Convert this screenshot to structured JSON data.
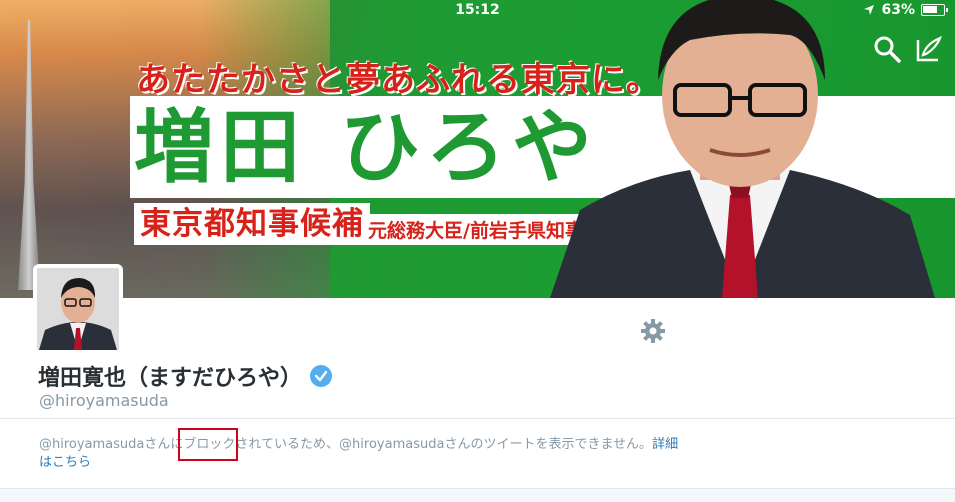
{
  "status_bar": {
    "time": "15:12",
    "battery": "63%"
  },
  "banner": {
    "slogan": "あたたかさと夢あふれる東京に。",
    "candidate_name": "増田 ひろや",
    "candidate_title": "東京都知事候補",
    "candidate_sub": "元総務大臣/前岩手県知事"
  },
  "profile": {
    "display_name": "増田寛也（ますだひろや）",
    "handle": "@hiroyamasuda",
    "verified": true
  },
  "blocked_notice": {
    "handle_1": "@hiroyamasuda",
    "text_1": "さんに",
    "highlighted": "ブロック",
    "text_2": "されているため、",
    "handle_2": "@hiroyamasuda",
    "text_3": "さんのツイートを表示できません。",
    "link": "詳細はこちら"
  },
  "colors": {
    "banner_green": "#1f9a33",
    "slogan_red": "#d7221a",
    "verified_blue": "#55acee",
    "link_blue": "#2b7bb9",
    "highlight_red": "#d0021b"
  },
  "icons": [
    "search-icon",
    "compose-icon",
    "location-arrow-icon",
    "battery-icon",
    "gear-icon",
    "verified-badge-icon"
  ]
}
